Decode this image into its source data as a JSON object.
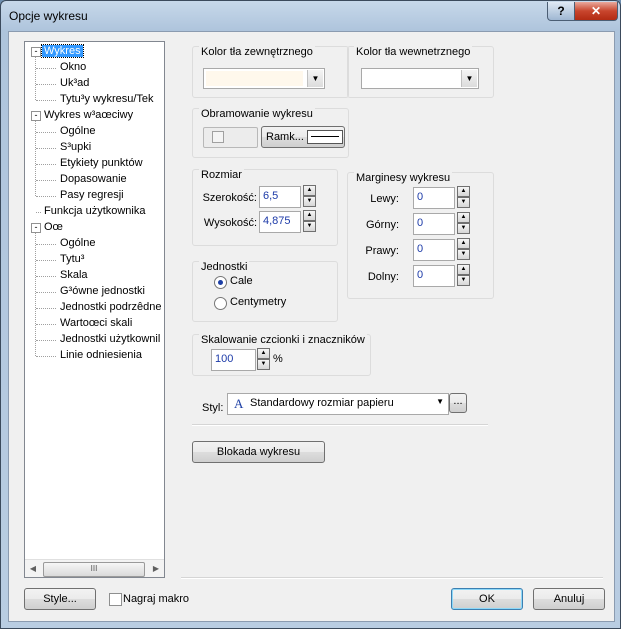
{
  "window": {
    "title": "Opcje wykresu",
    "help_label": "?",
    "close_label": "✕"
  },
  "tree": {
    "items": [
      {
        "label": "Wykres",
        "expander": "-"
      },
      {
        "label": "Okno"
      },
      {
        "label": "Uk³ad"
      },
      {
        "label": "Tytu³y wykresu/Tek"
      },
      {
        "label": "Wykres w³aœciwy",
        "expander": "-"
      },
      {
        "label": "Ogólne"
      },
      {
        "label": "S³upki"
      },
      {
        "label": "Etykiety punktów"
      },
      {
        "label": "Dopasowanie"
      },
      {
        "label": "Pasy regresji"
      },
      {
        "label": "Funkcja użytkownika"
      },
      {
        "label": "Oœ",
        "expander": "-"
      },
      {
        "label": "Ogólne"
      },
      {
        "label": "Tytu³"
      },
      {
        "label": "Skala"
      },
      {
        "label": "G³ówne jednostki"
      },
      {
        "label": "Jednostki podrzêdne"
      },
      {
        "label": "Wartoœci skali"
      },
      {
        "label": "Jednostki użytkownil"
      },
      {
        "label": "Linie odniesienia"
      }
    ],
    "scroll_thumb_glyph": "III"
  },
  "outer_bg": {
    "label": "Kolor tła zewnętrznego",
    "value": ""
  },
  "inner_bg": {
    "label": "Kolor tła wewnetrznego",
    "value": ""
  },
  "border": {
    "label": "Obramowanie wykresu",
    "frame_button": "Ramk..."
  },
  "size": {
    "label": "Rozmiar",
    "width_label": "Szerokość:",
    "width_value": "6,5",
    "height_label": "Wysokość:",
    "height_value": "4,875"
  },
  "margins": {
    "label": "Marginesy wykresu",
    "left_label": "Lewy:",
    "left_value": "0",
    "top_label": "Górny:",
    "top_value": "0",
    "right_label": "Prawy:",
    "right_value": "0",
    "bottom_label": "Dolny:",
    "bottom_value": "0"
  },
  "units": {
    "label": "Jednostki",
    "inches": "Cale",
    "cm": "Centymetry",
    "selected": "Cale"
  },
  "scaling": {
    "label": "Skalowanie czcionki i znaczników",
    "value": "100",
    "unit": "%"
  },
  "style": {
    "label": "Styl:",
    "icon_glyph": "A",
    "value": "Standardowy rozmiar papieru",
    "browse_label": "..."
  },
  "lock_button": "Blokada wykresu",
  "footer": {
    "style_button": "Style...",
    "record_macro": "Nagraj makro",
    "ok": "OK",
    "cancel": "Anuluj"
  },
  "colors": {
    "accent": "#3399ff",
    "outer_bg_swatch": "#fff8ec",
    "value_text": "#1c3aa8"
  }
}
